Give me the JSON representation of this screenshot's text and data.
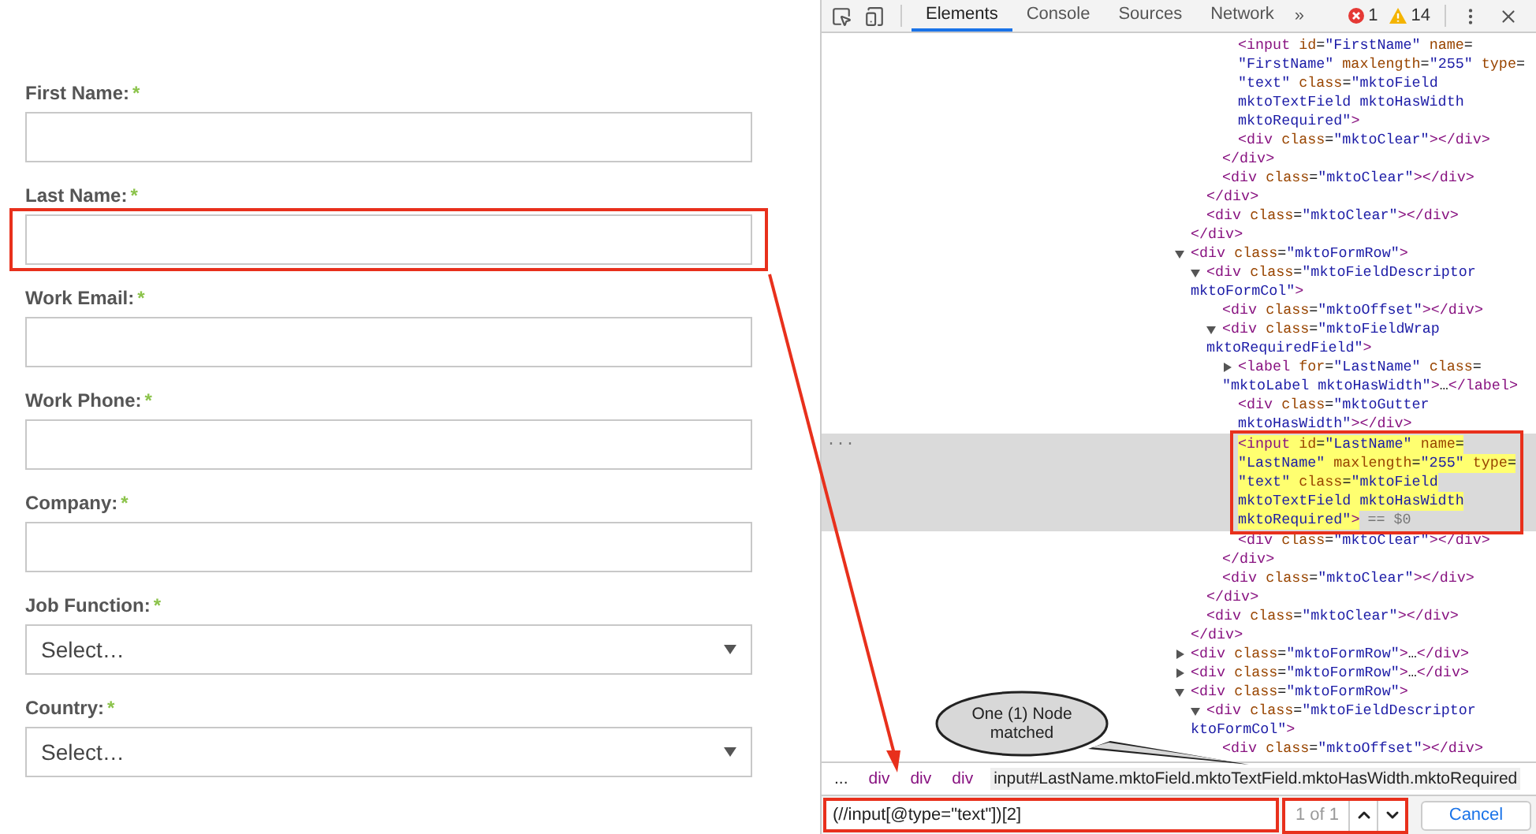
{
  "form": {
    "fields": [
      {
        "label": "First Name:",
        "required_mark": "*",
        "kind": "text",
        "highlighted": false
      },
      {
        "label": "Last Name:",
        "required_mark": "*",
        "kind": "text",
        "highlighted": true
      },
      {
        "label": "Work Email:",
        "required_mark": "*",
        "kind": "text",
        "highlighted": false
      },
      {
        "label": "Work Phone:",
        "required_mark": "*",
        "kind": "text",
        "highlighted": false
      },
      {
        "label": "Company:",
        "required_mark": "*",
        "kind": "text",
        "highlighted": false
      },
      {
        "label": "Job Function:",
        "required_mark": "*",
        "kind": "select",
        "value": "Select…",
        "highlighted": false
      },
      {
        "label": "Country:",
        "required_mark": "*",
        "kind": "select",
        "value": "Select…",
        "highlighted": false
      }
    ]
  },
  "devtools": {
    "tabs": [
      {
        "label": "Elements",
        "selected": true
      },
      {
        "label": "Console",
        "selected": false
      },
      {
        "label": "Sources",
        "selected": false
      },
      {
        "label": "Network",
        "selected": false
      }
    ],
    "more_tabs": "»",
    "errors": "1",
    "warnings": "14",
    "tree": [
      {
        "children": [
          {
            "children": [
              {
                "children": [
                  {
                    "lines": [
                      "<input id=\"FirstName\" name=",
                      "\"FirstName\" maxlength=\"255\" type=",
                      "\"text\" class=\"mktoField",
                      "mktoTextField mktoHasWidth",
                      "mktoRequired\">"
                    ],
                    "selected": false
                  },
                  {
                    "lines": [
                      "<div class=\"mktoClear\"></div>"
                    ],
                    "selected": false
                  }
                ]
              },
              {
                "lines": [
                  "</div>"
                ],
                "selected": false
              },
              {
                "lines": [
                  "<div class=\"mktoClear\"></div>"
                ],
                "selected": false
              }
            ]
          },
          {
            "lines": [
              "</div>"
            ],
            "selected": false
          },
          {
            "lines": [
              "<div class=\"mktoClear\"></div>"
            ],
            "selected": false
          }
        ]
      },
      {
        "lines": [
          "</div>"
        ],
        "selected": false
      },
      {
        "lines": [
          "<div class=\"mktoFormRow\">"
        ],
        "expanded": true,
        "selected": false,
        "children": [
          {
            "lines": [
              "<div class=\"mktoFieldDescriptor",
              "mktoFormCol\">"
            ],
            "expanded": true,
            "selected": false,
            "children": [
              {
                "lines": [
                  "<div class=\"mktoOffset\"></div>"
                ],
                "selected": false
              },
              {
                "lines": [
                  "<div class=\"mktoFieldWrap",
                  "mktoRequiredField\">"
                ],
                "expanded": true,
                "selected": false,
                "children": [
                  {
                    "lines": [
                      "<label for=\"LastName\" class=",
                      "\"mktoLabel mktoHasWidth\">…</label>"
                    ],
                    "expanded": false,
                    "selected": false
                  },
                  {
                    "lines": [
                      "<div class=\"mktoGutter",
                      "mktoHasWidth\"></div>"
                    ],
                    "selected": false
                  },
                  {
                    "lines": [
                      "<input id=\"LastName\" name=",
                      "\"LastName\" maxlength=\"255\" type=",
                      "\"text\" class=\"mktoField",
                      "mktoTextField mktoHasWidth",
                      "mktoRequired\">"
                    ],
                    "selected": true,
                    "marker": "== $0",
                    "menu": "...",
                    "highlighted": true
                  },
                  {
                    "lines": [
                      "<div class=\"mktoClear\"></div>"
                    ],
                    "selected": false
                  }
                ]
              },
              {
                "lines": [
                  "</div>"
                ],
                "selected": false
              },
              {
                "lines": [
                  "<div class=\"mktoClear\"></div>"
                ],
                "selected": false
              }
            ]
          },
          {
            "lines": [
              "</div>"
            ],
            "selected": false
          },
          {
            "lines": [
              "<div class=\"mktoClear\"></div>"
            ],
            "selected": false
          }
        ]
      },
      {
        "lines": [
          "</div>"
        ],
        "selected": false
      },
      {
        "lines": [
          "<div class=\"mktoFormRow\">…</div>"
        ],
        "expanded": false,
        "selected": false
      },
      {
        "lines": [
          "<div class=\"mktoFormRow\">…</div>"
        ],
        "expanded": false,
        "selected": false
      },
      {
        "lines": [
          "<div class=\"mktoFormRow\">"
        ],
        "expanded": true,
        "selected": false,
        "children": [
          {
            "lines": [
              "<div class=\"mktoFieldDescriptor",
              "ktoFormCol\">"
            ],
            "expanded": true,
            "selected": false,
            "children": [
              {
                "lines": [
                  "<div class=\"mktoOffset\"></div>"
                ],
                "selected": false
              }
            ]
          }
        ]
      }
    ],
    "breadcrumb_overflow": "...",
    "breadcrumbs": [
      {
        "label": "div",
        "selected": false
      },
      {
        "label": "div",
        "selected": false
      },
      {
        "label": "div",
        "selected": false
      },
      {
        "label": "input#LastName.mktoField.mktoTextField.mktoHasWidth.mktoRequired",
        "selected": true
      }
    ],
    "search": {
      "value": "(//input[@type=\"text\"])[2]",
      "highlighted": true
    },
    "match": {
      "count": "1 of 1",
      "highlighted": true
    },
    "cancel": "Cancel"
  },
  "callout": {
    "lines": [
      "One (1) Node",
      "matched"
    ]
  }
}
